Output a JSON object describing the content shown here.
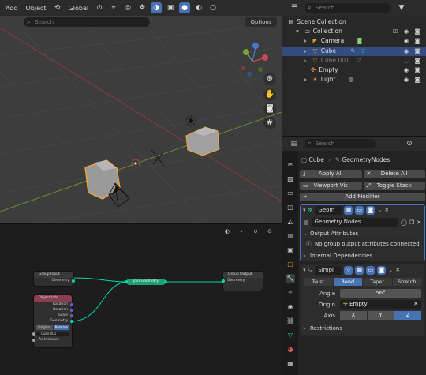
{
  "viewport": {
    "menu": [
      "Add",
      "Object"
    ],
    "orientation": "Global",
    "search_placeholder": "Search",
    "options_label": "Options"
  },
  "node_editor": {
    "group_input": {
      "title": "Group Input",
      "output": "Geometry"
    },
    "object_info": {
      "title": "Object Info",
      "outputs": [
        "Location",
        "Rotation",
        "Scale",
        "Geometry"
      ],
      "toggle": [
        "Original",
        "Relative"
      ],
      "object": "Cube.001",
      "as_instance": "As Instance"
    },
    "pill_label": "Join Geometry",
    "group_output": {
      "title": "Group Output",
      "input": "Geometry"
    }
  },
  "outliner": {
    "search_placeholder": "Search",
    "rows": [
      {
        "label": "Scene Collection"
      },
      {
        "label": "Collection"
      },
      {
        "label": "Camera"
      },
      {
        "label": "Cube"
      },
      {
        "label": "Cube.001"
      },
      {
        "label": "Empty"
      },
      {
        "label": "Light"
      }
    ]
  },
  "properties": {
    "search_placeholder": "Search",
    "breadcrumb": [
      "Cube",
      "GeometryNodes"
    ],
    "apply_all": "Apply All",
    "delete_all": "Delete All",
    "viewport_vis": "Viewport Vis",
    "toggle_stack": "Toggle Stack",
    "add_modifier": "Add Modifier",
    "geo_modifier": {
      "name": "Geom",
      "node_group": "Geometry Nodes",
      "output_attributes": "Output Attributes",
      "info": "No group output attributes connected",
      "internal_deps": "Internal Dependencies"
    },
    "deform_modifier": {
      "name": "Simpl",
      "modes": [
        "Twist",
        "Bend",
        "Taper",
        "Stretch"
      ],
      "active_mode": "Bend",
      "angle_label": "Angle",
      "angle_value": "56°",
      "origin_label": "Origin",
      "origin_value": "Empty",
      "axis_label": "Axis",
      "axes": [
        "X",
        "Y",
        "Z"
      ],
      "active_axis": "Z",
      "restrictions": "Restrictions"
    }
  },
  "colors": {
    "accent": "#4772b3",
    "selected_row": "#334d80",
    "geometry_socket": "#00d6a3",
    "node_pill": "#1e9e72"
  }
}
